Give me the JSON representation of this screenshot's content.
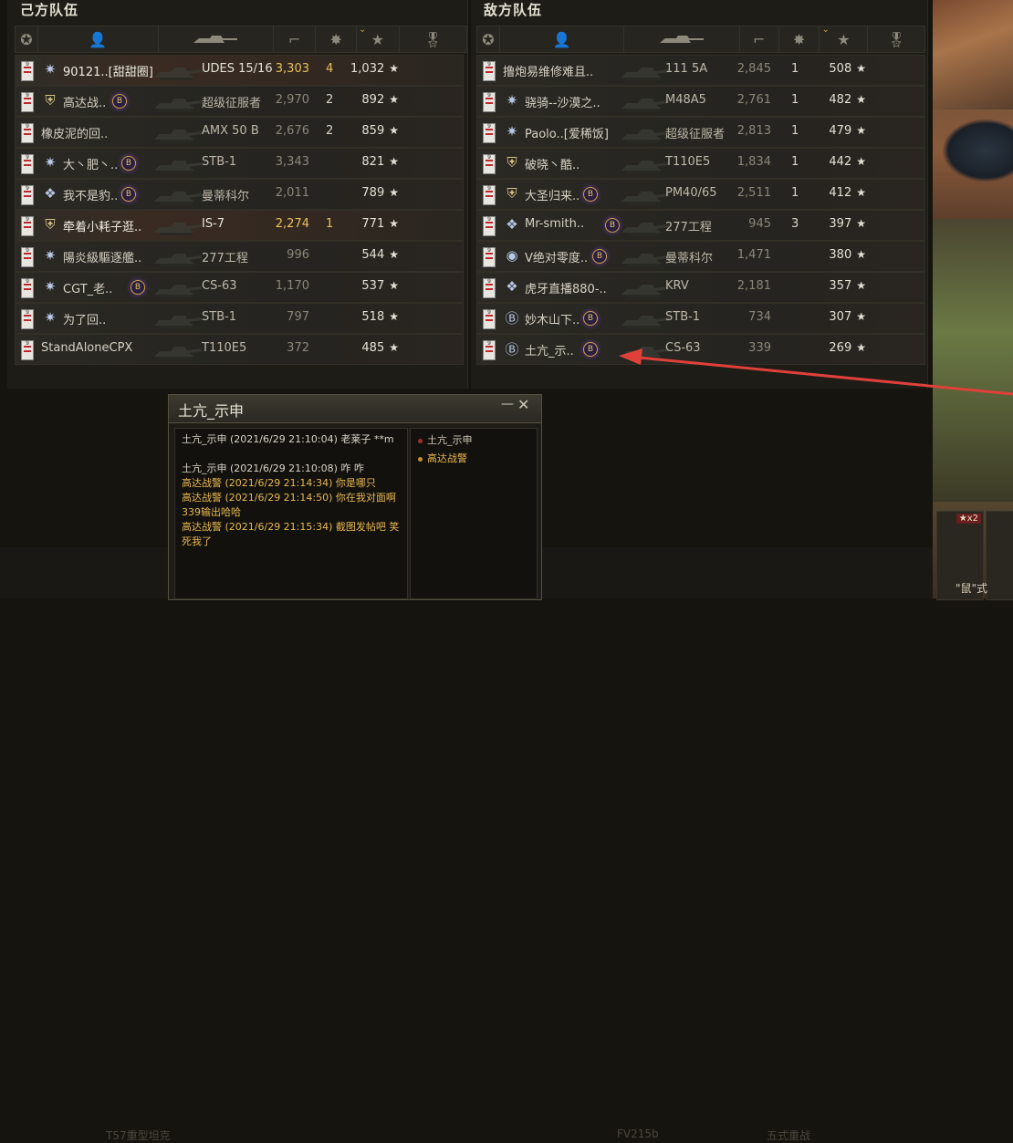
{
  "allies_title": "己方队伍",
  "enemies_title": "敌方队伍",
  "allies": [
    {
      "name": "90121..[甜甜圈]",
      "icon": "star",
      "clan": false,
      "tank": "UDES 15/16",
      "damage": "3,303",
      "kills": "4",
      "exp": "1,032",
      "bright": true
    },
    {
      "name": "高达战..",
      "icon": "shield",
      "clan": true,
      "tank": "超级征服者",
      "damage": "2,970",
      "kills": "2",
      "exp": "892",
      "bright": false
    },
    {
      "name": "橡皮泥的回..",
      "icon": "",
      "clan": false,
      "tank": "AMX 50 B",
      "damage": "2,676",
      "kills": "2",
      "exp": "859",
      "bright": false
    },
    {
      "name": "大丶肥丶..",
      "icon": "star",
      "clan": true,
      "tank": "STB-1",
      "damage": "3,343",
      "kills": "",
      "exp": "821",
      "bright": false
    },
    {
      "name": "我不是豹..",
      "icon": "diamond",
      "clan": true,
      "tank": "曼蒂科尔",
      "damage": "2,011",
      "kills": "",
      "exp": "789",
      "bright": false
    },
    {
      "name": "牵着小耗子逛..",
      "icon": "shield",
      "clan": false,
      "tank": "IS-7",
      "damage": "2,274",
      "kills": "1",
      "exp": "771",
      "bright": true
    },
    {
      "name": "陽炎級驅逐艦..",
      "icon": "star",
      "clan": false,
      "tank": "277工程",
      "damage": "996",
      "kills": "",
      "exp": "544",
      "bright": false
    },
    {
      "name": "CGT_老..",
      "icon": "star",
      "clan": true,
      "tank": "CS-63",
      "damage": "1,170",
      "kills": "",
      "exp": "537",
      "bright": false
    },
    {
      "name": "为了回..",
      "icon": "star",
      "clan": false,
      "tank": "STB-1",
      "damage": "797",
      "kills": "",
      "exp": "518",
      "bright": false
    },
    {
      "name": "StandAloneCPX",
      "icon": "",
      "clan": false,
      "tank": "T110E5",
      "damage": "372",
      "kills": "",
      "exp": "485",
      "bright": false
    }
  ],
  "enemies": [
    {
      "name": "撸炮易维修难且..",
      "icon": "",
      "clan": false,
      "tank": "111 5A",
      "damage": "2,845",
      "kills": "1",
      "exp": "508"
    },
    {
      "name": "骁骑--沙漠之..",
      "icon": "star",
      "clan": false,
      "tank": "M48A5",
      "damage": "2,761",
      "kills": "1",
      "exp": "482"
    },
    {
      "name": "Paolo..[爱稀饭]",
      "icon": "star",
      "clan": false,
      "tank": "超级征服者",
      "damage": "2,813",
      "kills": "1",
      "exp": "479"
    },
    {
      "name": "破晓丶酷..",
      "icon": "shield",
      "clan": false,
      "tank": "T110E5",
      "damage": "1,834",
      "kills": "1",
      "exp": "442"
    },
    {
      "name": "大圣归来..",
      "icon": "shield",
      "clan": true,
      "tank": "PM40/65",
      "damage": "2,511",
      "kills": "1",
      "exp": "412"
    },
    {
      "name": "Mr-smith..",
      "icon": "diamond",
      "clan": true,
      "tank": "277工程",
      "damage": "945",
      "kills": "3",
      "exp": "397"
    },
    {
      "name": "V绝对零度..",
      "icon": "coin",
      "clan": true,
      "tank": "曼蒂科尔",
      "damage": "1,471",
      "kills": "",
      "exp": "380"
    },
    {
      "name": "虎牙直播880-..",
      "icon": "diamond",
      "clan": false,
      "tank": "KRV",
      "damage": "2,181",
      "kills": "",
      "exp": "357"
    },
    {
      "name": "妙木山下..",
      "icon": "clanB",
      "clan": true,
      "tank": "STB-1",
      "damage": "734",
      "kills": "",
      "exp": "307"
    },
    {
      "name": "土亢_示..",
      "icon": "clanB",
      "clan": true,
      "tank": "CS-63",
      "damage": "339",
      "kills": "",
      "exp": "269"
    }
  ],
  "rank_number": "9",
  "star_glyph": "★",
  "chat": {
    "title": "土亢_示申",
    "minimize": "—",
    "close": "✕",
    "messages": [
      {
        "text": "土亢_示申 (2021/6/29 21:10:04) 老莱子 **m",
        "gold": false
      },
      {
        "text": "土亢_示申 (2021/6/29 21:10:08) 咋 咋",
        "gold": false
      },
      {
        "text": "高达战警 (2021/6/29 21:14:34) 你是哪只",
        "gold": true
      },
      {
        "text": "高达战警 (2021/6/29 21:14:50) 你在我对面啊 339输出哈哈",
        "gold": true
      },
      {
        "text": "高达战警 (2021/6/29 21:15:34) 截图发帖吧 笑死我了",
        "gold": true
      }
    ],
    "users": [
      {
        "name": "土亢_示申",
        "gold": false
      },
      {
        "name": "高达战警",
        "gold": true
      }
    ]
  },
  "bottom": {
    "left_text": "T57重型坦克",
    "mid_text": "FV215b",
    "mid2_text": "五式重战",
    "card_badge": "★x2",
    "card_label": "\"鼠\"式"
  }
}
